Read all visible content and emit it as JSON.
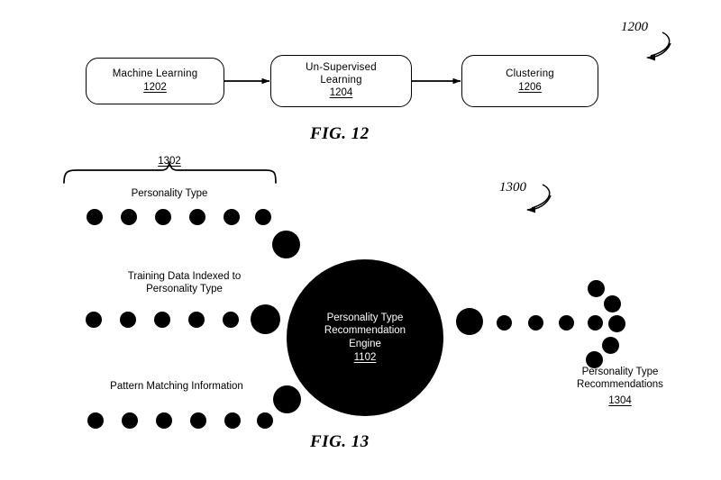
{
  "figures": [
    {
      "id": "fig12",
      "caption": "FIG. 12",
      "reference_number": "1200",
      "boxes": [
        {
          "label": "Machine  Learning",
          "number": "1202"
        },
        {
          "label": "Un-Supervised\nLearning",
          "number": "1204"
        },
        {
          "label": "Clustering",
          "number": "1206"
        }
      ]
    },
    {
      "id": "fig13",
      "caption": "FIG. 13",
      "reference_number": "1300",
      "bracket_number": "1302",
      "input_groups": [
        {
          "label": "Personality Type",
          "dots": 6
        },
        {
          "label": "Training Data Indexed to\nPersonality Type",
          "dots": 5
        },
        {
          "label": "Pattern Matching Information",
          "dots": 6
        }
      ],
      "engine": {
        "label": "Personality Type\nRecommendation\nEngine",
        "number": "1102"
      },
      "output": {
        "label": "Personality Type\nRecommendations",
        "number": "1304",
        "stream_dots": 5,
        "cluster_dots": 6
      }
    }
  ],
  "colors": {
    "ink": "#000000",
    "paper": "#ffffff",
    "engine_text": "#ffffff"
  }
}
